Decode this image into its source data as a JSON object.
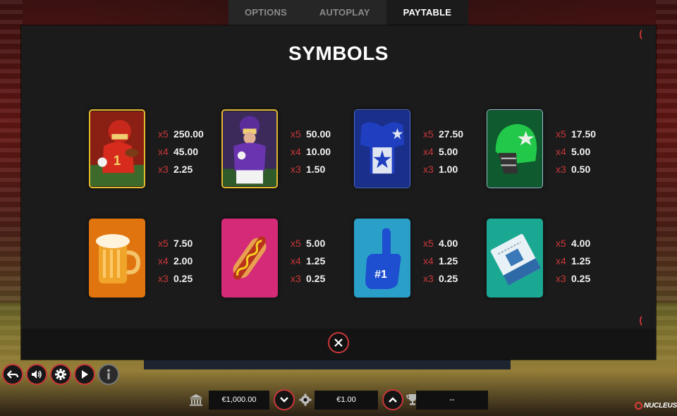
{
  "tabs": [
    {
      "label": "OPTIONS",
      "active": false
    },
    {
      "label": "AUTOPLAY",
      "active": false
    },
    {
      "label": "PAYTABLE",
      "active": true
    }
  ],
  "paytable": {
    "title": "SYMBOLS",
    "symbols": [
      {
        "icon": "red-football-player-icon",
        "pays": [
          {
            "count": "x5",
            "value": "250.00"
          },
          {
            "count": "x4",
            "value": "45.00"
          },
          {
            "count": "x3",
            "value": "2.25"
          }
        ]
      },
      {
        "icon": "purple-football-player-icon",
        "pays": [
          {
            "count": "x5",
            "value": "50.00"
          },
          {
            "count": "x4",
            "value": "10.00"
          },
          {
            "count": "x3",
            "value": "1.50"
          }
        ]
      },
      {
        "icon": "blue-jersey-icon",
        "pays": [
          {
            "count": "x5",
            "value": "27.50"
          },
          {
            "count": "x4",
            "value": "5.00"
          },
          {
            "count": "x3",
            "value": "1.00"
          }
        ]
      },
      {
        "icon": "green-helmet-icon",
        "pays": [
          {
            "count": "x5",
            "value": "17.50"
          },
          {
            "count": "x4",
            "value": "5.00"
          },
          {
            "count": "x3",
            "value": "0.50"
          }
        ]
      },
      {
        "icon": "beer-mug-icon",
        "pays": [
          {
            "count": "x5",
            "value": "7.50"
          },
          {
            "count": "x4",
            "value": "2.00"
          },
          {
            "count": "x3",
            "value": "0.25"
          }
        ]
      },
      {
        "icon": "hotdog-icon",
        "pays": [
          {
            "count": "x5",
            "value": "5.00"
          },
          {
            "count": "x4",
            "value": "1.25"
          },
          {
            "count": "x3",
            "value": "0.25"
          }
        ]
      },
      {
        "icon": "foam-finger-icon",
        "pays": [
          {
            "count": "x5",
            "value": "4.00"
          },
          {
            "count": "x4",
            "value": "1.25"
          },
          {
            "count": "x3",
            "value": "0.25"
          }
        ]
      },
      {
        "icon": "ticket-icon",
        "pays": [
          {
            "count": "x5",
            "value": "4.00"
          },
          {
            "count": "x4",
            "value": "1.25"
          },
          {
            "count": "x3",
            "value": "0.25"
          }
        ]
      }
    ],
    "foam_finger_text": "#1"
  },
  "bottom_bar": {
    "balance": "€1,000.00",
    "bet": "€1.00",
    "win": "--"
  },
  "brand": "NUCLEUS",
  "colors": {
    "accent": "#c9373a",
    "panel": "#1b1b1b"
  }
}
